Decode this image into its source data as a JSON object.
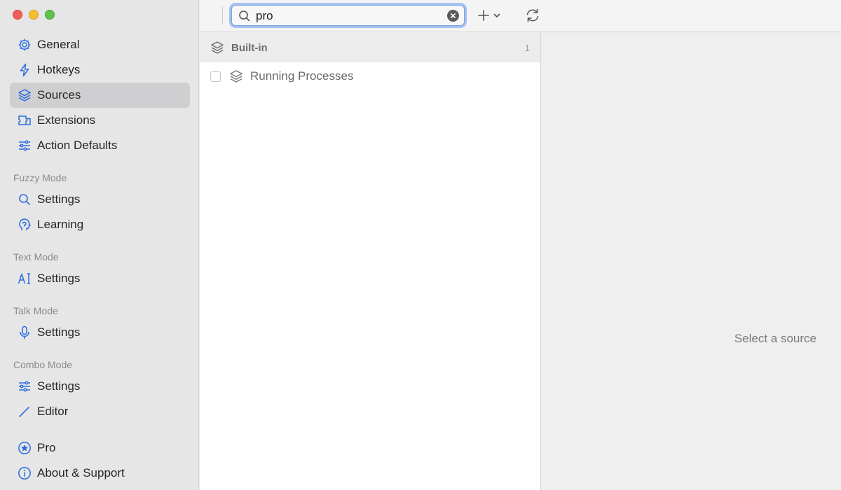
{
  "sidebar": {
    "items": [
      {
        "label": "General",
        "icon": "gear-icon"
      },
      {
        "label": "Hotkeys",
        "icon": "bolt-icon"
      },
      {
        "label": "Sources",
        "icon": "layers-icon",
        "selected": true
      },
      {
        "label": "Extensions",
        "icon": "extension-icon"
      },
      {
        "label": "Action Defaults",
        "icon": "sliders-icon"
      }
    ],
    "fuzzy": {
      "header": "Fuzzy Mode",
      "settings": "Settings",
      "learning": "Learning"
    },
    "text": {
      "header": "Text Mode",
      "settings": "Settings"
    },
    "talk": {
      "header": "Talk Mode",
      "settings": "Settings"
    },
    "combo": {
      "header": "Combo Mode",
      "settings": "Settings",
      "editor": "Editor"
    },
    "pro": "Pro",
    "about": "About & Support"
  },
  "toolbar": {
    "search_value": "pro",
    "add_label": "+",
    "icons": [
      "search-icon",
      "clear-icon",
      "plus-icon",
      "chevron-down-icon",
      "refresh-icon"
    ]
  },
  "list": {
    "group": {
      "label": "Built-in",
      "count": "1"
    },
    "items": [
      {
        "label": "Running Processes"
      }
    ]
  },
  "detail": {
    "placeholder": "Select a source"
  },
  "colors": {
    "accent": "#2d6cdf",
    "sidebar_bg": "#e6e6e6",
    "selected_bg": "#cfcfd1"
  }
}
